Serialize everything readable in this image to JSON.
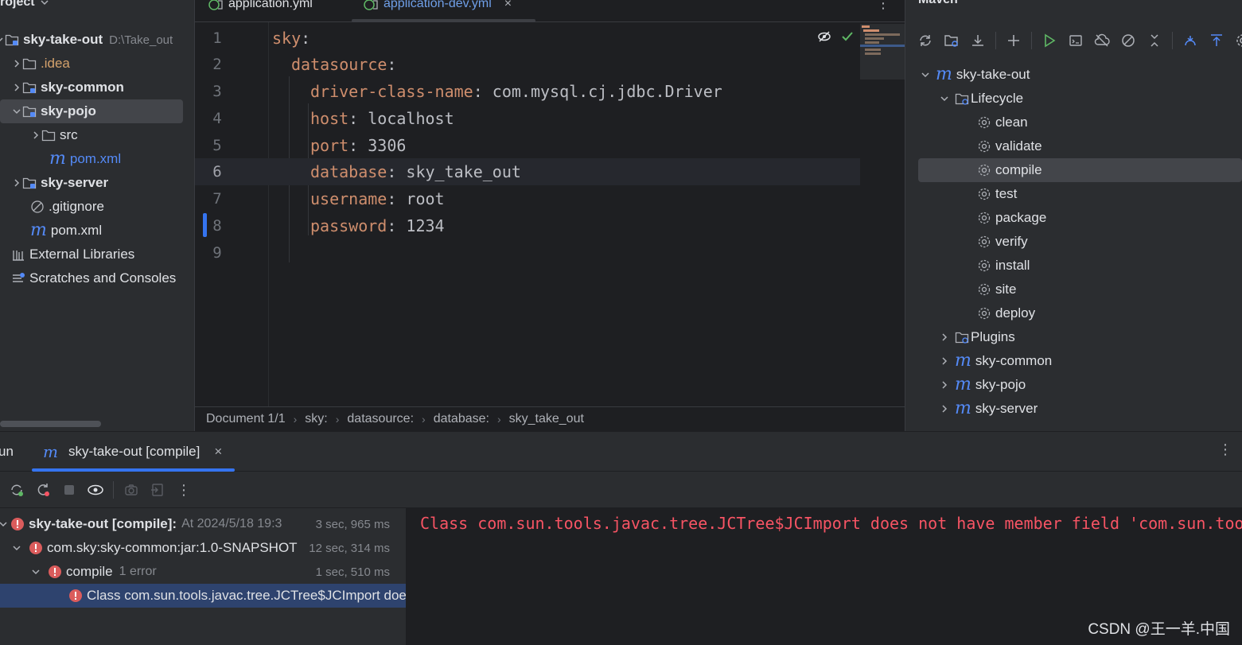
{
  "project": {
    "header": "roject",
    "items": [
      {
        "label": "sky-take-out",
        "path": "D:\\Take_out"
      },
      {
        "label": ".idea"
      },
      {
        "label": "sky-common"
      },
      {
        "label": "sky-pojo"
      },
      {
        "label": "src"
      },
      {
        "label": "pom.xml"
      },
      {
        "label": "sky-server"
      },
      {
        "label": ".gitignore"
      },
      {
        "label": "pom.xml"
      },
      {
        "label": "External Libraries"
      },
      {
        "label": "Scratches and Consoles"
      }
    ]
  },
  "editor": {
    "tabs": [
      {
        "label": "application.yml"
      },
      {
        "label": "application-dev.yml",
        "close": "×"
      }
    ],
    "more": "⋮",
    "lines": [
      {
        "num": "1",
        "key": "sky",
        "sep": ":",
        "value": ""
      },
      {
        "num": "2",
        "key": "datasource",
        "sep": ":",
        "value": ""
      },
      {
        "num": "3",
        "key": "driver-class-name",
        "sep": ": ",
        "value": "com.mysql.cj.jdbc.Driver"
      },
      {
        "num": "4",
        "key": "host",
        "sep": ": ",
        "value": "localhost"
      },
      {
        "num": "5",
        "key": "port",
        "sep": ": ",
        "value": "3306"
      },
      {
        "num": "6",
        "key": "database",
        "sep": ": ",
        "value": "sky_take_out"
      },
      {
        "num": "7",
        "key": "username",
        "sep": ": ",
        "value": "root"
      },
      {
        "num": "8",
        "key": "password",
        "sep": ": ",
        "value": "1234"
      },
      {
        "num": "9",
        "key": "",
        "sep": "",
        "value": ""
      }
    ],
    "breadcrumbs": [
      "Document 1/1",
      "sky:",
      "datasource:",
      "database:",
      "sky_take_out"
    ],
    "breadcrumb_sep": "›"
  },
  "maven": {
    "title": "Maven",
    "root": "sky-take-out",
    "lifecycle": "Lifecycle",
    "phases": [
      "clean",
      "validate",
      "compile",
      "test",
      "package",
      "verify",
      "install",
      "site",
      "deploy"
    ],
    "plugins": "Plugins",
    "modules": [
      "sky-common",
      "sky-pojo",
      "sky-server"
    ]
  },
  "run": {
    "label": "un",
    "tab_label": "sky-take-out [compile]",
    "tab_close": "×",
    "more": "⋮",
    "tree": [
      {
        "label": "sky-take-out [compile]:",
        "detail": "At 2024/5/18 19:3",
        "time": "3 sec, 965 ms"
      },
      {
        "label": "com.sky:sky-common:jar:1.0-SNAPSHOT",
        "time": "12 sec, 314 ms"
      },
      {
        "label": "compile",
        "detail": "1 error",
        "time": "1 sec, 510 ms"
      },
      {
        "label": "Class com.sun.tools.javac.tree.JCTree$JCImport doe"
      }
    ],
    "console": "Class com.sun.tools.javac.tree.JCTree$JCImport does not have member field 'com.sun.too"
  },
  "watermark": "CSDN @王一羊.中国",
  "colors": {
    "accent": "#3574f0",
    "error": "#f75464",
    "yaml_key": "#cf8e6d",
    "maven_blue": "#548af7"
  }
}
